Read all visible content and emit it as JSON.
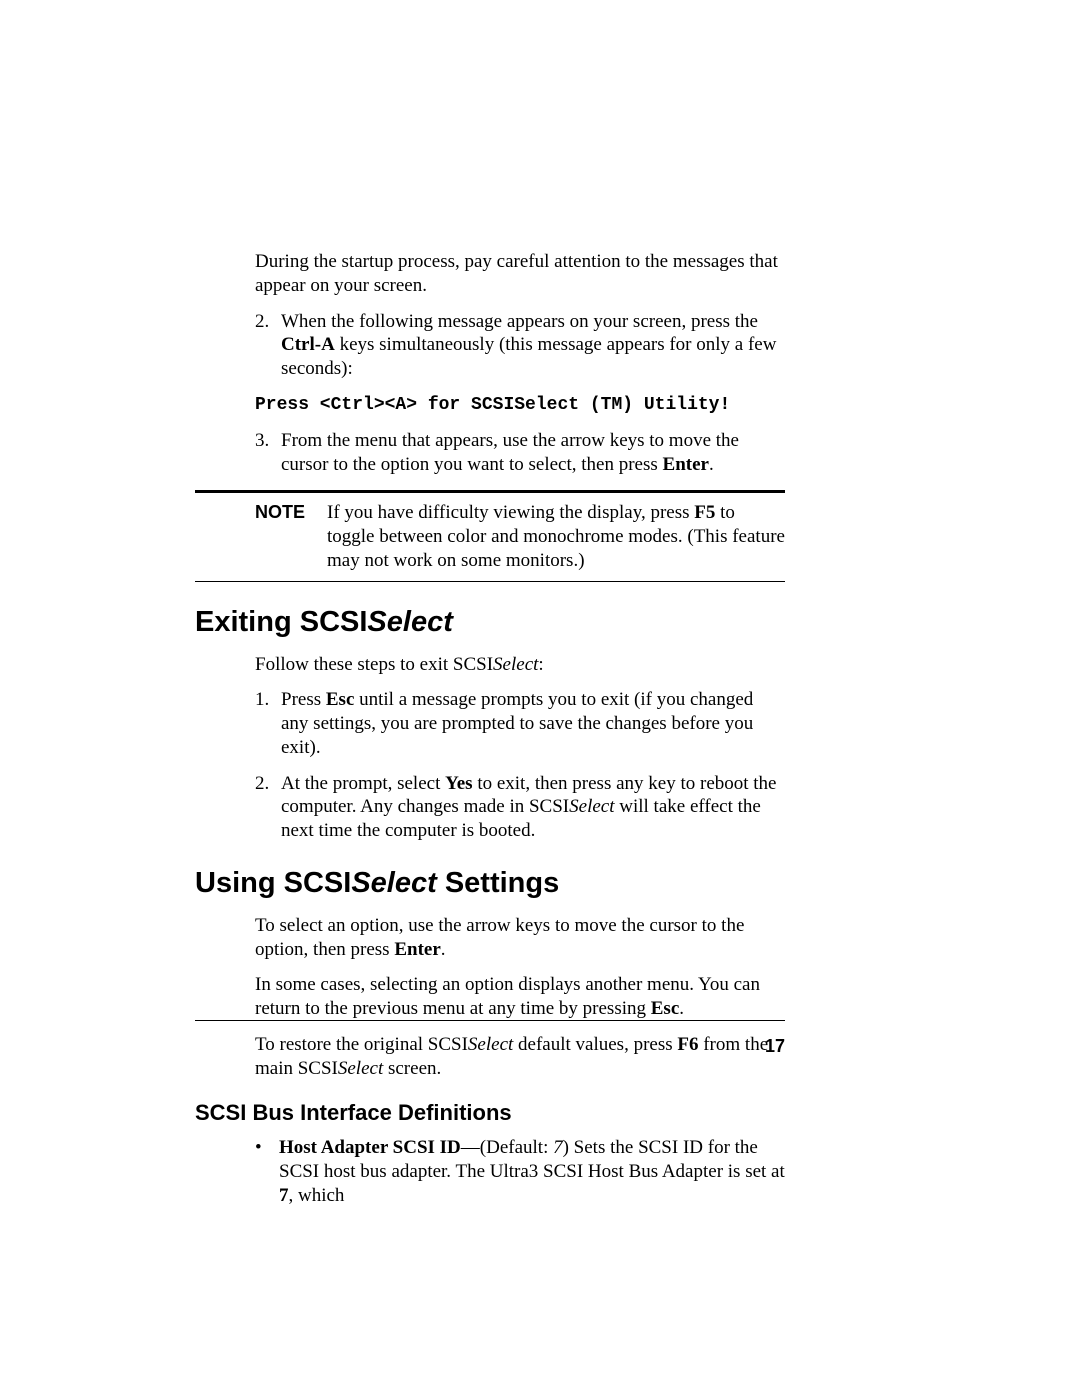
{
  "intro": {
    "startup": "During the startup process, pay careful attention to the messages that appear on your screen."
  },
  "steps_a": {
    "s2_pre": "When the following message appears on your screen, press the ",
    "s2_bold": "Ctrl-A",
    "s2_post": " keys simultaneously (this message appears for only a few seconds):",
    "code": "Press <Ctrl><A> for SCSISelect (TM) Utility!",
    "s3_pre": "From the menu that appears, use the arrow keys to move the cursor to the option you want to select, then press ",
    "s3_bold": "Enter",
    "s3_post": "."
  },
  "note": {
    "label": "NOTE",
    "pre": "If you have difficulty viewing the display, press ",
    "bold": "F5",
    "post": " to toggle between color and monochrome modes. (This feature may not work on some monitors.)"
  },
  "heading_exit_a": "Exiting SCSI",
  "heading_exit_b": "Select",
  "exit": {
    "intro_a": "Follow these steps to exit SCSI",
    "intro_b": "Select",
    "intro_c": ":",
    "s1_a": "Press ",
    "s1_b": "Esc",
    "s1_c": " until a message prompts you to exit (if you changed any settings, you are prompted to save the changes before you exit).",
    "s2_a": "At the prompt, select ",
    "s2_b": "Yes",
    "s2_c": " to exit, then press any key to reboot the computer. Any changes made in SCSI",
    "s2_d": "Select",
    "s2_e": " will take effect the next time the computer is booted."
  },
  "heading_using_a": "Using SCSI",
  "heading_using_b": "Select",
  "heading_using_c": " Settings",
  "using": {
    "p1_a": "To select an option, use the arrow keys to move the cursor to the option, then press ",
    "p1_b": "Enter",
    "p1_c": ".",
    "p2_a": "In some cases, selecting an option displays another menu. You can return to the previous menu at any time by pressing ",
    "p2_b": "Esc",
    "p2_c": ".",
    "p3_a": "To restore the original SCSI",
    "p3_b": "Select",
    "p3_c": " default values, press ",
    "p3_d": "F6",
    "p3_e": " from the main SCSI",
    "p3_f": "Select",
    "p3_g": " screen."
  },
  "subheading": "SCSI Bus Interface Definitions",
  "defn": {
    "b1_a": "Host Adapter SCSI ID",
    "b1_b": "—(Default: ",
    "b1_c": "7",
    "b1_d": ") Sets the SCSI ID for the SCSI host bus adapter. The Ultra3 SCSI Host Bus Adapter is set at ",
    "b1_e": "7",
    "b1_f": ", which"
  },
  "markers": {
    "m2": "2.",
    "m3": "3.",
    "m1": "1.",
    "bullet": "•"
  },
  "pagenum": "17"
}
